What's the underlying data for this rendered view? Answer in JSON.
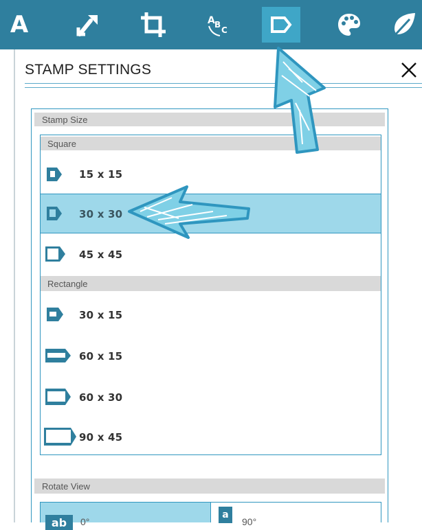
{
  "toolbar": {
    "tools": [
      {
        "name": "text-tool",
        "glyph": "A"
      },
      {
        "name": "resize-tool",
        "icon": "resize-arrow-icon"
      },
      {
        "name": "crop-tool",
        "icon": "crop-icon"
      },
      {
        "name": "text-path-tool",
        "icon": "abc-curve-icon"
      },
      {
        "name": "stamp-tool",
        "icon": "stamp-icon",
        "active": true
      },
      {
        "name": "color-tool",
        "icon": "palette-icon"
      },
      {
        "name": "effects-tool",
        "icon": "leaf-icon"
      }
    ]
  },
  "panel": {
    "title": "STAMP SETTINGS",
    "close_icon": "close-icon"
  },
  "stamp_size": {
    "section_label": "Stamp Size",
    "square_label": "Square",
    "square_options": [
      {
        "label": "15 x 15",
        "selected": false
      },
      {
        "label": "30 x 30",
        "selected": true
      },
      {
        "label": "45 x 45",
        "selected": false
      }
    ],
    "rectangle_label": "Rectangle",
    "rectangle_options": [
      {
        "label": "30 x 15"
      },
      {
        "label": "60 x 15"
      },
      {
        "label": "60 x 30"
      },
      {
        "label": "90 x 45"
      }
    ]
  },
  "rotate_view": {
    "section_label": "Rotate View",
    "options": [
      {
        "badge": "ab",
        "label": "0°",
        "selected": true
      },
      {
        "badge": "a",
        "label": "90°",
        "selected": false
      }
    ]
  },
  "colors": {
    "toolbar_bg": "#2f7f9e",
    "accent": "#2f96bf",
    "selected_bg": "#9ed8ea",
    "arrow_fill": "#7fd0e6"
  }
}
